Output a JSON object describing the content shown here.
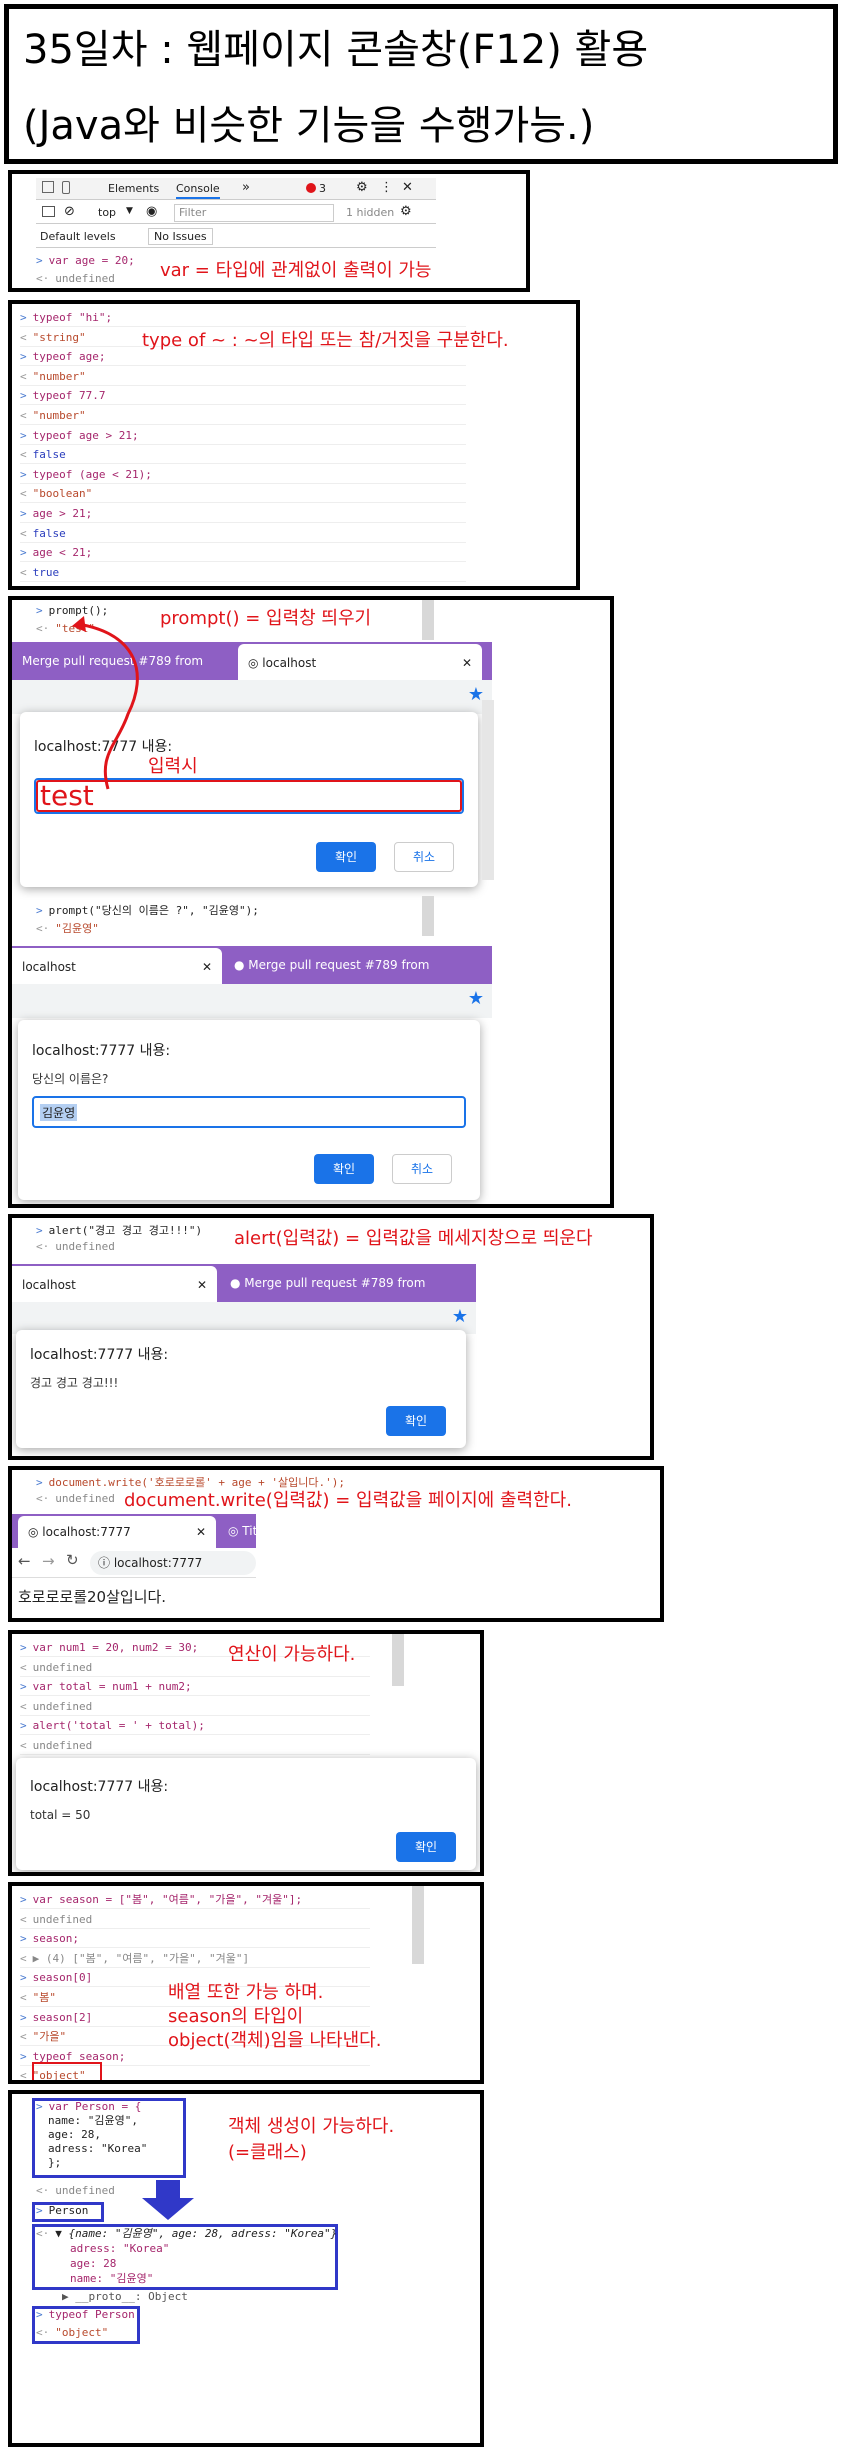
{
  "title": {
    "line1": "35일차 : 웹페이지 콘솔창(F12) 활용",
    "line2": "(Java와 비슷한 기능을 수행가능.)"
  },
  "devtools": {
    "tabs": [
      "Elements",
      "Console"
    ],
    "more": "»",
    "error_count": "3",
    "context": "top",
    "filter_placeholder": "Filter",
    "hidden": "1 hidden",
    "levels": "Default levels",
    "issues": "No Issues"
  },
  "sec1": {
    "code": "var age = 20;",
    "result": "undefined",
    "note": "var = 타입에 관계없이 출력이 가능"
  },
  "sec2": {
    "note": "type of ~ : ~의 타입 또는 참/거짓을 구분한다.",
    "lines": [
      {
        "p": ">",
        "t": "typeof \"hi\";"
      },
      {
        "p": "<",
        "t": "\"string\""
      },
      {
        "p": ">",
        "t": "typeof age;"
      },
      {
        "p": "<",
        "t": "\"number\""
      },
      {
        "p": ">",
        "t": "typeof 77.7"
      },
      {
        "p": "<",
        "t": "\"number\""
      },
      {
        "p": ">",
        "t": "typeof age > 21;"
      },
      {
        "p": "<",
        "t": "false"
      },
      {
        "p": ">",
        "t": "typeof (age < 21);"
      },
      {
        "p": "<",
        "t": "\"boolean\""
      },
      {
        "p": ">",
        "t": "age > 21;"
      },
      {
        "p": "<",
        "t": "false"
      },
      {
        "p": ">",
        "t": "age < 21;"
      },
      {
        "p": "<",
        "t": "true"
      }
    ]
  },
  "sec3": {
    "code1": "prompt();",
    "result1": "\"test\"",
    "note": "prompt() = 입력창 띄우기",
    "tab_merge": "Merge pull request #789 from",
    "tab_local": "localhost",
    "dialog_title": "localhost:7777 내용:",
    "input_value": "test",
    "input_note": "입력시",
    "ok": "확인",
    "cancel": "취소",
    "code2": "prompt(\"당신의 이름은 ?\", \"김윤영\");",
    "result2": "\"김윤영\"",
    "tab_local2": "localhost",
    "tab_merge2": "Merge pull request #789 from",
    "dialog_title2": "localhost:7777 내용:",
    "dialog_msg2": "당신의 이름은?",
    "input_value2": "김윤영"
  },
  "sec4": {
    "code": "alert(\"경고 경고 경고!!!\")",
    "result": "undefined",
    "note": "alert(입력값) = 입력값을 메세지창으로 띄운다",
    "tab_local": "localhost",
    "tab_merge": "Merge pull request #789 from",
    "dialog_title": "localhost:7777 내용:",
    "dialog_msg": "경고 경고 경고!!!",
    "ok": "확인"
  },
  "sec5": {
    "code": "document.write('호로로로롤' + age + '살입니다.');",
    "result": "undefined",
    "note": "document.write(입력값) = 입력값을 페이지에 출력한다.",
    "tab": "localhost:7777",
    "tab2": "Tit",
    "url": "localhost:7777",
    "page_text": "호로로로롤20살입니다."
  },
  "sec6": {
    "note": "연산이 가능하다.",
    "lines": [
      {
        "p": ">",
        "t": "var num1 = 20, num2 = 30;"
      },
      {
        "p": "<",
        "t": "undefined"
      },
      {
        "p": ">",
        "t": "var total = num1 + num2;"
      },
      {
        "p": "<",
        "t": "undefined"
      },
      {
        "p": ">",
        "t": "alert('total = ' + total);"
      },
      {
        "p": "<",
        "t": "undefined"
      }
    ],
    "dialog_title": "localhost:7777 내용:",
    "dialog_msg": "total = 50",
    "ok": "확인"
  },
  "sec7": {
    "note1": "배열 또한 가능 하며.",
    "note2": "season의 타입이",
    "note3": "object(객체)임을 나타낸다.",
    "lines": [
      {
        "p": ">",
        "t": "var season = [\"봄\", \"여름\", \"가을\", \"겨울\"];"
      },
      {
        "p": "<",
        "t": "undefined"
      },
      {
        "p": ">",
        "t": "season;"
      },
      {
        "p": "<",
        "t": "▶ (4) [\"봄\", \"여름\", \"가을\", \"겨울\"]"
      },
      {
        "p": ">",
        "t": "season[0]"
      },
      {
        "p": "<",
        "t": "\"봄\""
      },
      {
        "p": ">",
        "t": "season[2]"
      },
      {
        "p": "<",
        "t": "\"가을\""
      },
      {
        "p": ">",
        "t": "typeof season;"
      },
      {
        "p": "<",
        "t": "\"object\""
      }
    ]
  },
  "sec8": {
    "note1": "객체 생성이 가능하다.",
    "note2": "(=클래스)",
    "decl": [
      "var Person = {",
      "    name: \"김윤영\",",
      "    age: 28,",
      "    adress: \"Korea\"",
      "};"
    ],
    "undef": "undefined",
    "person": "Person",
    "obj_summary": "▼ {name: \"김윤영\", age: 28, adress: \"Korea\"}",
    "obj_props": [
      "adress: \"Korea\"",
      "age: 28",
      "name: \"김윤영\""
    ],
    "proto": "▶ __proto__: Object",
    "typeof": "typeof Person",
    "typeof_result": "\"object\""
  }
}
